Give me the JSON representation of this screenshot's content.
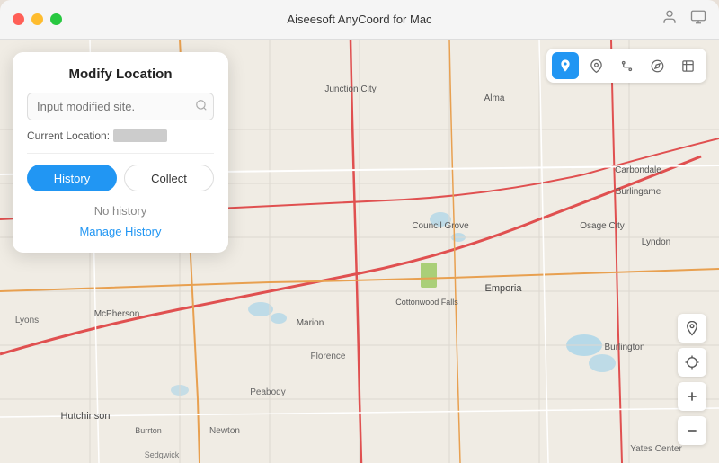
{
  "window": {
    "title": "Aiseesoft AnyCoord for Mac"
  },
  "titlebar": {
    "title": "Aiseesoft AnyCoord for Mac",
    "traffic_lights": [
      "red",
      "yellow",
      "green"
    ]
  },
  "panel": {
    "title": "Modify Location",
    "search_placeholder": "Input modified site.",
    "current_location_label": "Current Location:",
    "current_location_value": "██████",
    "tab_history": "History",
    "tab_collect": "Collect",
    "no_history": "No history",
    "manage_history": "Manage History"
  },
  "map_toolbar": {
    "tools": [
      "location",
      "pin",
      "route",
      "compass",
      "export"
    ]
  },
  "map_controls": {
    "location_btn": "◎",
    "crosshair_btn": "⊕",
    "zoom_in": "+",
    "zoom_out": "−"
  }
}
